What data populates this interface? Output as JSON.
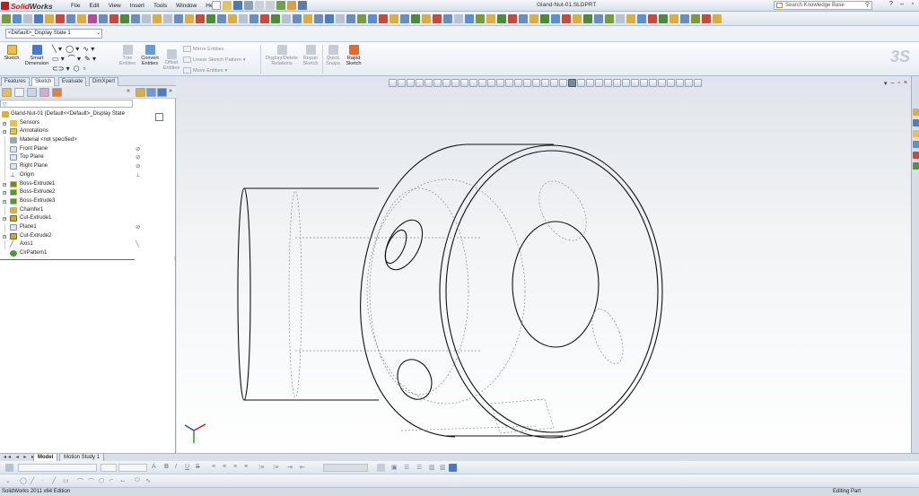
{
  "app": {
    "name_prefix": "Solid",
    "name_suffix": "Works",
    "document_title": "Gland-Nut-01.SLDPRT"
  },
  "menu": [
    "File",
    "Edit",
    "View",
    "Insert",
    "Tools",
    "Window",
    "Help"
  ],
  "search": {
    "placeholder": "Search Knowledge Base"
  },
  "config": {
    "selected": "<Default>_Display State 1"
  },
  "command_manager": {
    "sketch": "Sketch",
    "smart_dimension_1": "Smart",
    "smart_dimension_2": "Dimension",
    "trim_1": "Trim",
    "trim_2": "Entities",
    "convert_1": "Convert",
    "convert_2": "Entities",
    "offset_1": "Offset",
    "offset_2": "Entities",
    "mirror": "Mirror Entities",
    "linear_pattern": "Linear Sketch Pattern",
    "move": "Move Entities",
    "display_delete_1": "Display/Delete",
    "display_delete_2": "Relations",
    "repair_1": "Repair",
    "repair_2": "Sketch",
    "quick_snaps_1": "Quick",
    "quick_snaps_2": "Snaps",
    "rapid_sketch_1": "Rapid",
    "rapid_sketch_2": "Sketch"
  },
  "tabs": [
    "Features",
    "Sketch",
    "Evaluate",
    "DimXpert"
  ],
  "tree": {
    "root": "Gland-Nut-01  (Default<<Default>_Display State",
    "items": [
      "Sensors",
      "Annotations",
      "Material <not specified>",
      "Front Plane",
      "Top Plane",
      "Right Plane",
      "Origin",
      "Boss-Extrude1",
      "Boss-Extrude2",
      "Boss-Extrude3",
      "Chamfer1",
      "Cut-Extrude1",
      "Plane1",
      "Cut-Extrude2",
      "Axis1",
      "CirPattern1"
    ]
  },
  "bottom_tabs": [
    "Model",
    "Motion Study 1"
  ],
  "status": {
    "left": "SolidWorks 2011 x64 Edition",
    "right": "Editing Part"
  },
  "colors": {
    "accent": "#c8161d",
    "selection_blue": "#3d6ec2",
    "folder_yellow": "#e8c04a",
    "feature_green": "#4a9a3a"
  }
}
